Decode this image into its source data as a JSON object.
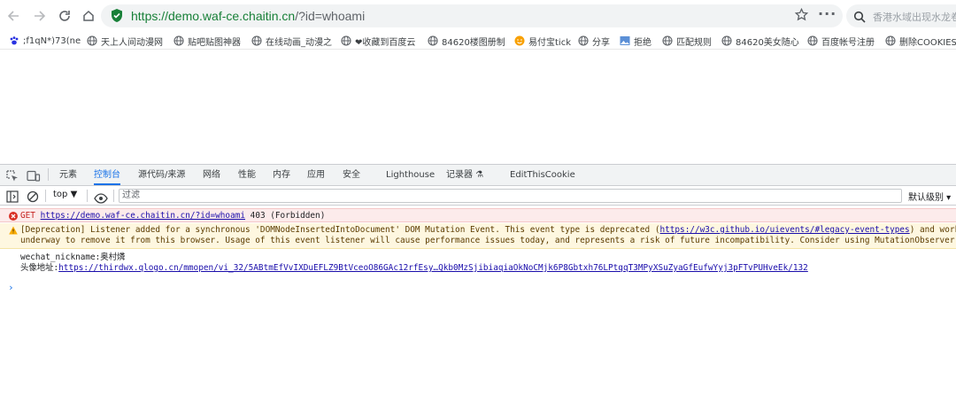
{
  "browser": {
    "url_host": "https://demo.waf-ce.chaitin.cn",
    "url_rest": "/?id=whoami",
    "search_placeholder": "香港水域出现水龙卷"
  },
  "bookmarks": [
    {
      "label": ";f1qN*)73(ne",
      "icon": "paw-icon"
    },
    {
      "label": "天上人间动漫网",
      "icon": "globe-icon"
    },
    {
      "label": "贴吧贴图神器",
      "icon": "globe-icon"
    },
    {
      "label": "在线动画_动漫之",
      "icon": "globe-icon"
    },
    {
      "label": "❤收藏到百度云",
      "icon": "globe-icon"
    },
    {
      "label": "84620楼图册制",
      "icon": "globe-icon"
    },
    {
      "label": "易付宝tick",
      "icon": "smile-icon"
    },
    {
      "label": "分享",
      "icon": "globe-icon"
    },
    {
      "label": "拒绝",
      "icon": "image-icon"
    },
    {
      "label": "匹配规则",
      "icon": "globe-icon"
    },
    {
      "label": "84620美女随心",
      "icon": "globe-icon"
    },
    {
      "label": "百度帐号注册",
      "icon": "globe-icon"
    },
    {
      "label": "删除COOKIES",
      "icon": "globe-icon"
    }
  ],
  "devtools": {
    "tabs": [
      "元素",
      "控制台",
      "源代码/来源",
      "网络",
      "性能",
      "内存",
      "应用",
      "安全",
      "Lighthouse",
      "记录器 ⚗",
      "EditThisCookie"
    ],
    "active_tab": "控制台",
    "context": "top ▼",
    "filter_placeholder": "过滤",
    "levels": "默认级别 ▾"
  },
  "console": {
    "error": {
      "method": "GET",
      "url": "https://demo.waf-ce.chaitin.cn/?id=whoami",
      "status": "403 (Forbidden)"
    },
    "warning": {
      "prefix": "[Deprecation] Listener added for a synchronous 'DOMNodeInsertedIntoDocument' DOM Mutation Event. This event type is deprecated (",
      "link": "https://w3c.github.io/uievents/#legacy-event-types",
      "suffix": ") and work is",
      "line2": "underway to remove it from this browser. Usage of this event listener will cause performance issues today, and represents a risk of future incompatibility. Consider using MutationObserver ins"
    },
    "log": {
      "line1": "wechat_nickname:奥村燐",
      "line2_label": "头像地址:",
      "line2_link": "https://thirdwx.qlogo.cn/mmopen/vi_32/5ABtmEfVvIXDuEFLZ9BtVceoO86GAc12rfEsy…Qkb0MzSjibiaqiaOkNoCMjk6P8Gbtxh76LPtqqT3MPyXSuZyaGfEufwYyj3pFTvPUHveEk/132"
    },
    "prompt": "›"
  },
  "colors": {
    "accent": "#1a73e8",
    "error_bg": "#fcebeb",
    "warn_bg": "#fef7e0",
    "secure_green": "#188038"
  }
}
